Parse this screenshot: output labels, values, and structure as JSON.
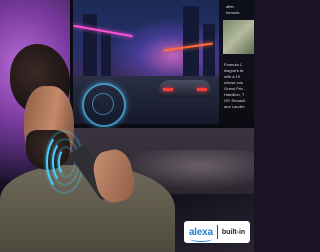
{
  "photo": {
    "subject": "man with remote",
    "colors": {
      "ambient": "#b86bd6",
      "wave": "#45d0ff",
      "badge_bg": "#ffffff",
      "alexa_blue": "#1f7fd0"
    }
  },
  "tv_panel": {
    "lines_top": [
      "after",
      "formula"
    ],
    "lines_bottom": [
      "Formula 1",
      "league's fa",
      "with a 19",
      "whose cus",
      "Grand Prix",
      "Hamilton, T",
      "GP, Renault",
      "and Lauder."
    ]
  },
  "badge": {
    "brand": "alexa",
    "suffix": "built-in"
  }
}
